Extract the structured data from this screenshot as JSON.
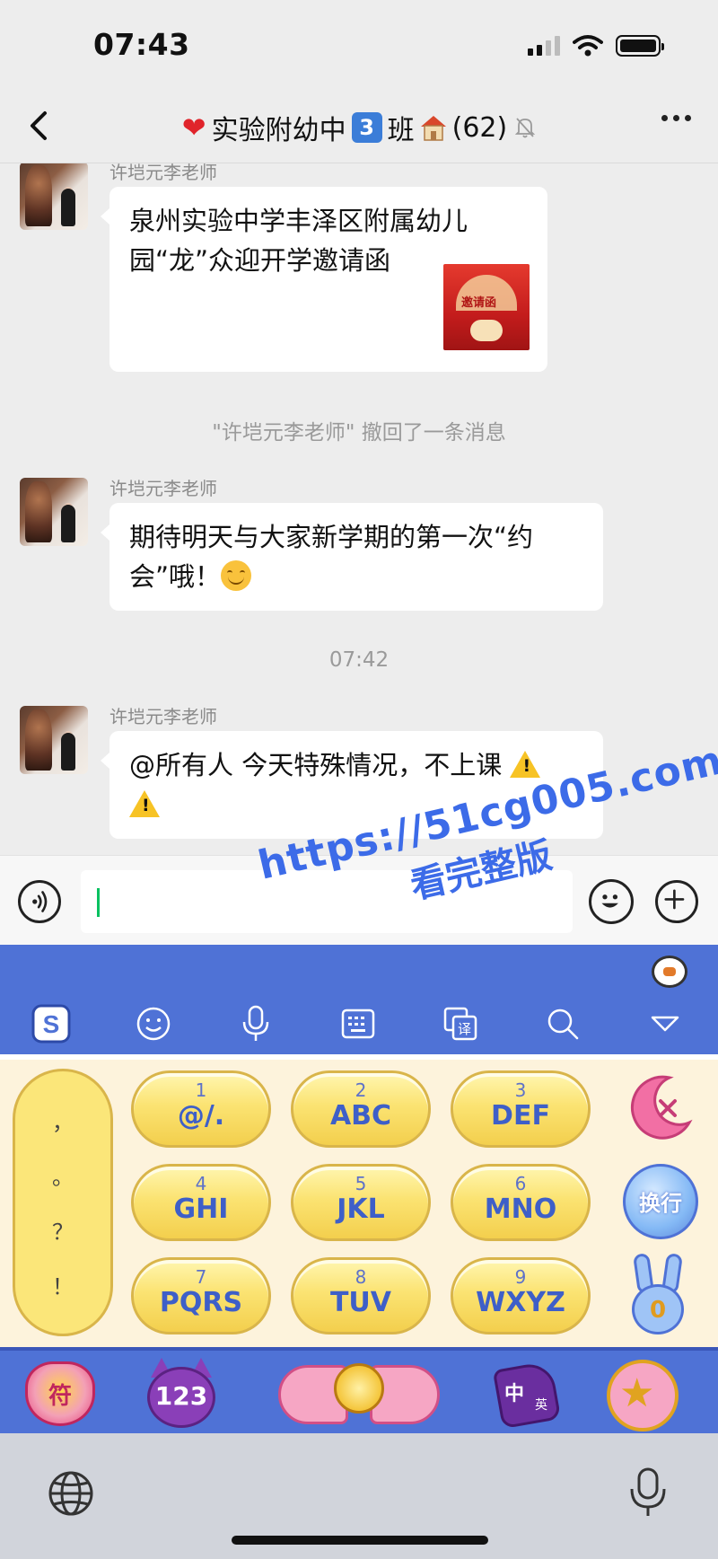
{
  "status": {
    "time": "07:43"
  },
  "header": {
    "title_prefix": "实验附幼中",
    "class_number": "3",
    "title_suffix": "班",
    "member_count": "(62)",
    "heart_icon": "heart-icon",
    "house_icon": "house-icon",
    "mute_icon": "bell-muted-icon"
  },
  "messages": [
    {
      "sender": "许垲元李老师",
      "text": "泉州实验中学丰泽区附属幼儿园“龙”众迎开学邀请函",
      "card_thumb_label": "邀请函"
    },
    {
      "system": "\"许垲元李老师\" 撤回了一条消息"
    },
    {
      "sender": "许垲元李老师",
      "text": "期待明天与大家新学期的第一次“约会”哦！"
    },
    {
      "timestamp": "07:42"
    },
    {
      "sender": "许垲元李老师",
      "text": "@所有人  今天特殊情况，不上课"
    }
  ],
  "watermark": {
    "line1": "https://51cg005.com",
    "line2": "看完整版"
  },
  "keyboard": {
    "toolbar": [
      "sogou-logo-icon",
      "emoji-icon",
      "mic-icon",
      "keyboard-icon",
      "translate-icon",
      "search-icon",
      "collapse-icon"
    ],
    "translate_label": "译",
    "punctuation": [
      "，",
      "。",
      "？",
      "！"
    ],
    "keys": [
      {
        "num": "1",
        "letters": "@/."
      },
      {
        "num": "2",
        "letters": "ABC"
      },
      {
        "num": "3",
        "letters": "DEF"
      },
      {
        "num": "4",
        "letters": "GHI"
      },
      {
        "num": "5",
        "letters": "JKL"
      },
      {
        "num": "6",
        "letters": "MNO"
      },
      {
        "num": "7",
        "letters": "PQRS"
      },
      {
        "num": "8",
        "letters": "TUV"
      },
      {
        "num": "9",
        "letters": "WXYZ"
      }
    ],
    "enter_label": "换行",
    "zero_label": "0",
    "symbol_label": "符",
    "numbers_label": "123",
    "lang_label": "中",
    "lang_sub": "英"
  },
  "colors": {
    "accent": "#07c160",
    "keyboard_blue": "#4f72d6",
    "key_yellow": "#fbe372"
  }
}
